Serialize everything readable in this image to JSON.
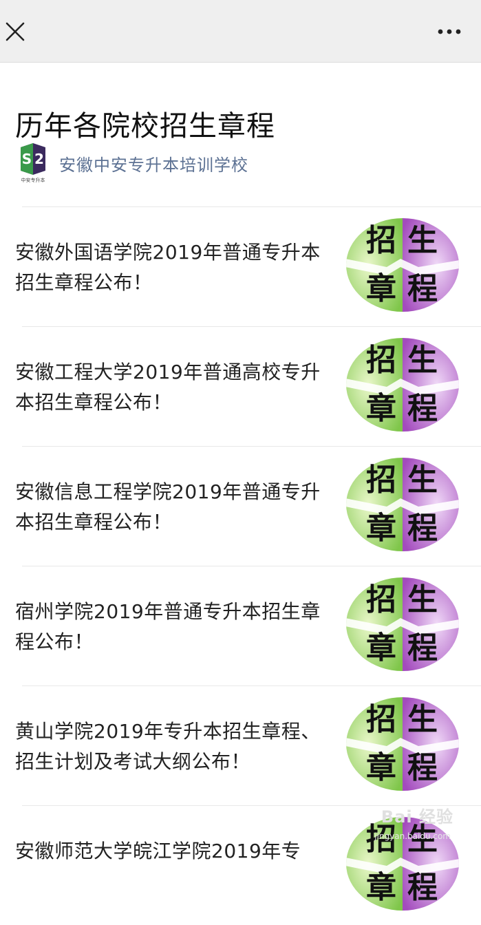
{
  "header": {
    "close_icon": "close-icon",
    "more_icon": "more-options-icon"
  },
  "article": {
    "title": "历年各院校招生章程",
    "account_name": "安徽中安专升本培训学校",
    "account_logo_text": "中安专升本"
  },
  "thumbnail": {
    "chars": [
      "招",
      "生",
      "章",
      "程"
    ],
    "colors": {
      "green": "#7fc64a",
      "purple": "#a34bbd",
      "text": "#111111"
    }
  },
  "items": [
    {
      "title": "安徽外国语学院2019年普通专升本招生章程公布！"
    },
    {
      "title": "安徽工程大学2019年普通高校专升本招生章程公布！"
    },
    {
      "title": "安徽信息工程学院2019年普通专升本招生章程公布！"
    },
    {
      "title": "宿州学院2019年普通专升本招生章程公布！"
    },
    {
      "title": "黄山学院2019年专升本招生章程、招生计划及考试大纲公布！"
    },
    {
      "title": "安徽师范大学皖江学院2019年专"
    }
  ],
  "watermark": {
    "text": "Bai 经验",
    "sub": "jingyan.baidu.com"
  }
}
